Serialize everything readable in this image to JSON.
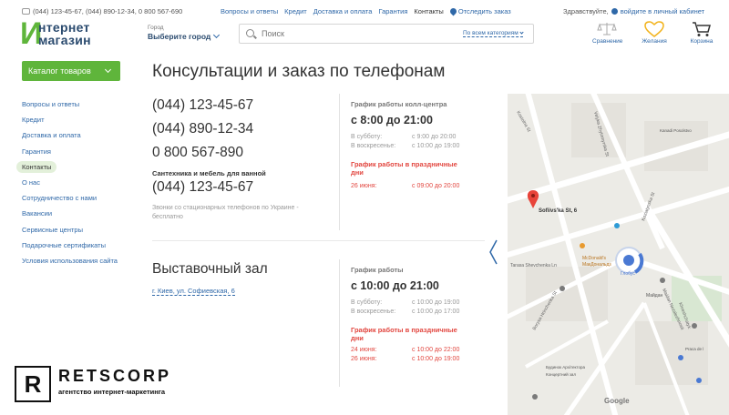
{
  "topbar": {
    "phones": "(044) 123-45-67, (044) 890-12-34, 0 800 567-690",
    "nav": [
      "Вопросы и ответы",
      "Кредит",
      "Доставка и оплата",
      "Гарантия",
      "Контакты"
    ],
    "track_label": "Отследить заказ",
    "greeting": "Здравствуйте,",
    "cabinet_label": "войдите в личный кабинет"
  },
  "logo": {
    "letter": "И",
    "line1": "нтернет",
    "line2": "магазин"
  },
  "city": {
    "label": "Город",
    "value": "Выберите город"
  },
  "search": {
    "placeholder": "Поиск",
    "category": "По всем категориям"
  },
  "header_icons": {
    "compare": "Сравнение",
    "wishlist": "Желания",
    "cart": "Корзина"
  },
  "catalog_button": "Каталог товаров",
  "sidebar": [
    "Вопросы и ответы",
    "Кредит",
    "Доставка и оплата",
    "Гарантия",
    "Контакты",
    "О нас",
    "Сотрудничество с нами",
    "Вакансии",
    "Сервисные центры",
    "Подарочные сертификаты",
    "Условия использования сайта"
  ],
  "page_title": "Консультации и заказ по телефонам",
  "phones": [
    "(044) 123-45-67",
    "(044) 890-12-34",
    "0 800 567-890"
  ],
  "plumbing": {
    "title": "Сантехника и мебель для ванной",
    "phone": "(044) 123-45-67",
    "note": "Звонки со стационарных телефонов по Украине - бесплатно"
  },
  "callcenter": {
    "title": "График работы колл-центра",
    "hours": "с 8:00 до 21:00",
    "rows": [
      {
        "day": "В субботу:",
        "time": "с 9:00 до 20:00"
      },
      {
        "day": "В воскресенье:",
        "time": "с 10:00 до 19:00"
      }
    ],
    "holiday_title": "График работы в праздничные дни",
    "holiday_rows": [
      {
        "day": "26 июня:",
        "time": "с 09:00 до 20:00"
      }
    ]
  },
  "hall": {
    "title": "Выставочный зал",
    "address": "г. Киев, ул. Софиевская, 6",
    "sched_title": "График работы",
    "hours": "с 10:00 до 21:00",
    "rows": [
      {
        "day": "В субботу:",
        "time": "с 10:00 до 19:00"
      },
      {
        "day": "В воскресенье:",
        "time": "с 10:00 до 17:00"
      }
    ],
    "holiday_title": "График работы в праздничные дни",
    "holiday_rows": [
      {
        "day": "24 июня:",
        "time": "с 10:00 до 22:00"
      },
      {
        "day": "26 июня:",
        "time": "с 10:00 до 19:00"
      }
    ]
  },
  "map": {
    "marker_label": "Sofiivs'ka St, 6",
    "labels": {
      "mcdonalds": "McDonald's",
      "mcdonalds_ru": "МакДональдз",
      "nezalezhnosti": "Maidan Nezalezhnosti",
      "khreshchatyk": "Khreshchatyk",
      "koziatyn": "Koziatynska St",
      "tarasa": "Tarasa Shevchenka Ln",
      "velyka": "Velyka Zhytomyrska St",
      "borysa": "Borysa Hrinchenka St",
      "kostolna": "Kostolna St",
      "hlibmarket": "Глобус",
      "maidan": "Майдан",
      "kanada": "Kanadi Posolstvo",
      "ploshcha": "Praca de l",
      "arkhitektora": "Будинок Архітектора",
      "kontsert": "Концертний зал",
      "google": "Google"
    }
  },
  "watermark": {
    "letter": "R",
    "name": "RETSCORP",
    "tagline": "агентство интернет-маркетинга"
  }
}
